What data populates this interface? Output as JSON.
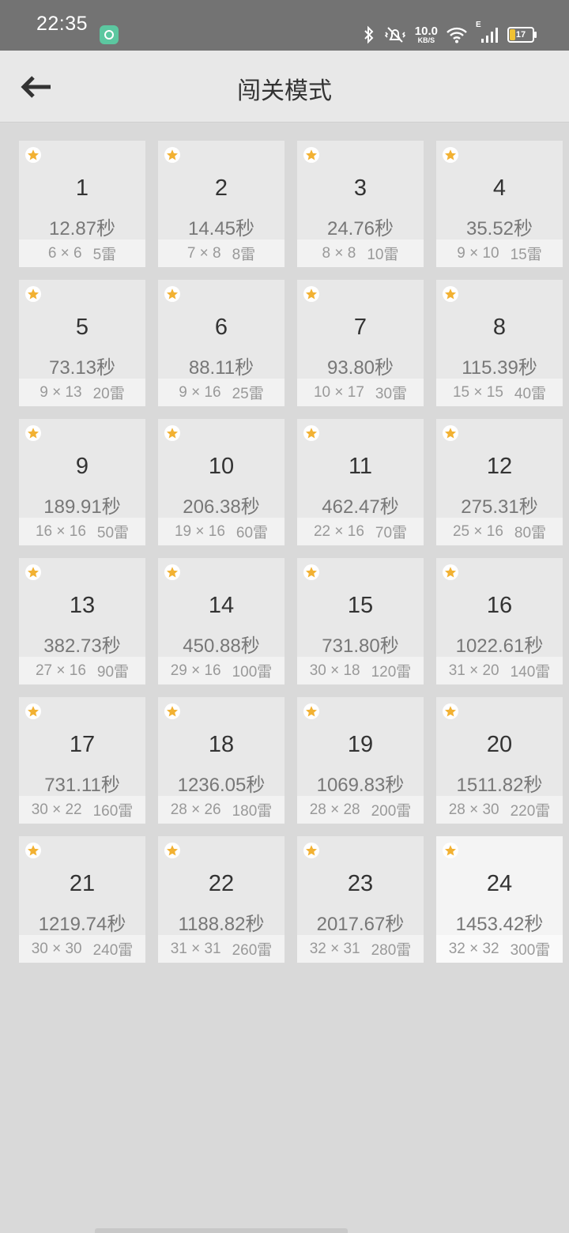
{
  "status_bar": {
    "time": "22:35",
    "net_speed_value": "10.0",
    "net_speed_unit": "KB/S",
    "network_type": "E",
    "battery_level": "17",
    "icons": [
      "app-notification-icon",
      "bluetooth-icon",
      "vibrate-icon",
      "wifi-icon",
      "signal-icon",
      "battery-icon"
    ]
  },
  "header": {
    "title": "闯关模式"
  },
  "colors": {
    "star": "#f2b132",
    "tile_bg": "#e8e8e8",
    "selected_tile_bg": "#f4f4f4"
  },
  "selected_level": "24",
  "levels": [
    {
      "num": "1",
      "time": "12.87秒",
      "size": "6 × 6",
      "mines": "5雷"
    },
    {
      "num": "2",
      "time": "14.45秒",
      "size": "7 × 8",
      "mines": "8雷"
    },
    {
      "num": "3",
      "time": "24.76秒",
      "size": "8 × 8",
      "mines": "10雷"
    },
    {
      "num": "4",
      "time": "35.52秒",
      "size": "9 × 10",
      "mines": "15雷"
    },
    {
      "num": "5",
      "time": "73.13秒",
      "size": "9 × 13",
      "mines": "20雷"
    },
    {
      "num": "6",
      "time": "88.11秒",
      "size": "9 × 16",
      "mines": "25雷"
    },
    {
      "num": "7",
      "time": "93.80秒",
      "size": "10 × 17",
      "mines": "30雷"
    },
    {
      "num": "8",
      "time": "115.39秒",
      "size": "15 × 15",
      "mines": "40雷"
    },
    {
      "num": "9",
      "time": "189.91秒",
      "size": "16 × 16",
      "mines": "50雷"
    },
    {
      "num": "10",
      "time": "206.38秒",
      "size": "19 × 16",
      "mines": "60雷"
    },
    {
      "num": "11",
      "time": "462.47秒",
      "size": "22 × 16",
      "mines": "70雷"
    },
    {
      "num": "12",
      "time": "275.31秒",
      "size": "25 × 16",
      "mines": "80雷"
    },
    {
      "num": "13",
      "time": "382.73秒",
      "size": "27 × 16",
      "mines": "90雷"
    },
    {
      "num": "14",
      "time": "450.88秒",
      "size": "29 × 16",
      "mines": "100雷"
    },
    {
      "num": "15",
      "time": "731.80秒",
      "size": "30 × 18",
      "mines": "120雷"
    },
    {
      "num": "16",
      "time": "1022.61秒",
      "size": "31 × 20",
      "mines": "140雷"
    },
    {
      "num": "17",
      "time": "731.11秒",
      "size": "30 × 22",
      "mines": "160雷"
    },
    {
      "num": "18",
      "time": "1236.05秒",
      "size": "28 × 26",
      "mines": "180雷"
    },
    {
      "num": "19",
      "time": "1069.83秒",
      "size": "28 × 28",
      "mines": "200雷"
    },
    {
      "num": "20",
      "time": "1511.82秒",
      "size": "28 × 30",
      "mines": "220雷"
    },
    {
      "num": "21",
      "time": "1219.74秒",
      "size": "30 × 30",
      "mines": "240雷"
    },
    {
      "num": "22",
      "time": "1188.82秒",
      "size": "31 × 31",
      "mines": "260雷"
    },
    {
      "num": "23",
      "time": "2017.67秒",
      "size": "32 × 31",
      "mines": "280雷"
    },
    {
      "num": "24",
      "time": "1453.42秒",
      "size": "32 × 32",
      "mines": "300雷"
    }
  ]
}
